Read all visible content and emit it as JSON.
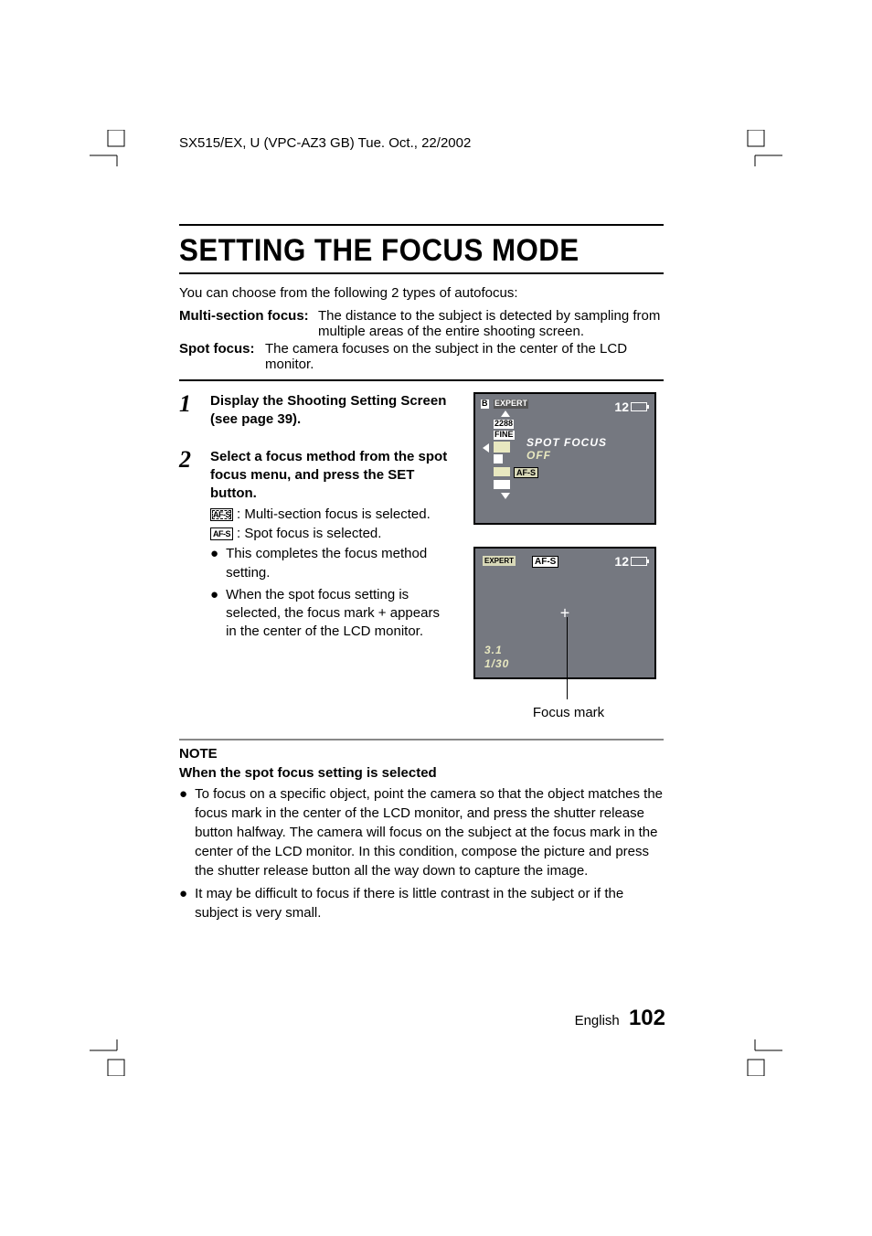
{
  "header": "SX515/EX, U (VPC-AZ3 GB)   Tue. Oct., 22/2002",
  "title": "SETTING THE FOCUS MODE",
  "intro": "You can choose from the following 2 types of autofocus:",
  "definitions": {
    "multi": {
      "term": "Multi-section focus:",
      "desc": "The distance to the subject is detected by sampling from multiple areas of the entire shooting screen."
    },
    "spot": {
      "term": "Spot focus:",
      "desc": "The camera focuses on the subject in the center of the LCD monitor."
    }
  },
  "steps": [
    {
      "num": "1",
      "head": "Display the Shooting Setting Screen (see page 39)."
    },
    {
      "num": "2",
      "head": "Select a focus method from the spot focus menu, and press the SET button."
    }
  ],
  "step2_items": {
    "multi": ": Multi-section focus is selected.",
    "spot": ": Spot focus is selected.",
    "bullet1": "This completes the focus method setting.",
    "bullet2": "When the spot focus setting is selected, the focus mark + appears in the center of the LCD monitor."
  },
  "lcd1": {
    "badge_b": "B",
    "badge_expert": "EXPERT",
    "badge_2288": "2288",
    "badge_fine": "FINE",
    "count": "12",
    "menu1": "SPOT FOCUS",
    "menu2": "OFF",
    "afs": "AF-S"
  },
  "lcd2": {
    "expert": "EXPERT",
    "afs": "AF-S",
    "count": "12",
    "num1": "3.1",
    "num2": "1/30"
  },
  "focus_mark_label": "Focus mark",
  "note": {
    "head": "NOTE",
    "sub": "When the spot focus setting is selected",
    "b1": "To focus on a specific object, point the camera so that the object matches the focus mark in the center of the LCD monitor, and press the shutter release button halfway. The camera will focus on the subject at the focus mark in the center of the LCD monitor. In this condition, compose the picture and press the shutter release button all the way down to capture the image.",
    "b2": "It may be difficult to focus if there is little contrast in the subject or if the subject is very small."
  },
  "footer": {
    "lang": "English",
    "page": "102"
  },
  "icons": {
    "afs_multi": "AF-S",
    "afs_spot": "AF-S"
  }
}
